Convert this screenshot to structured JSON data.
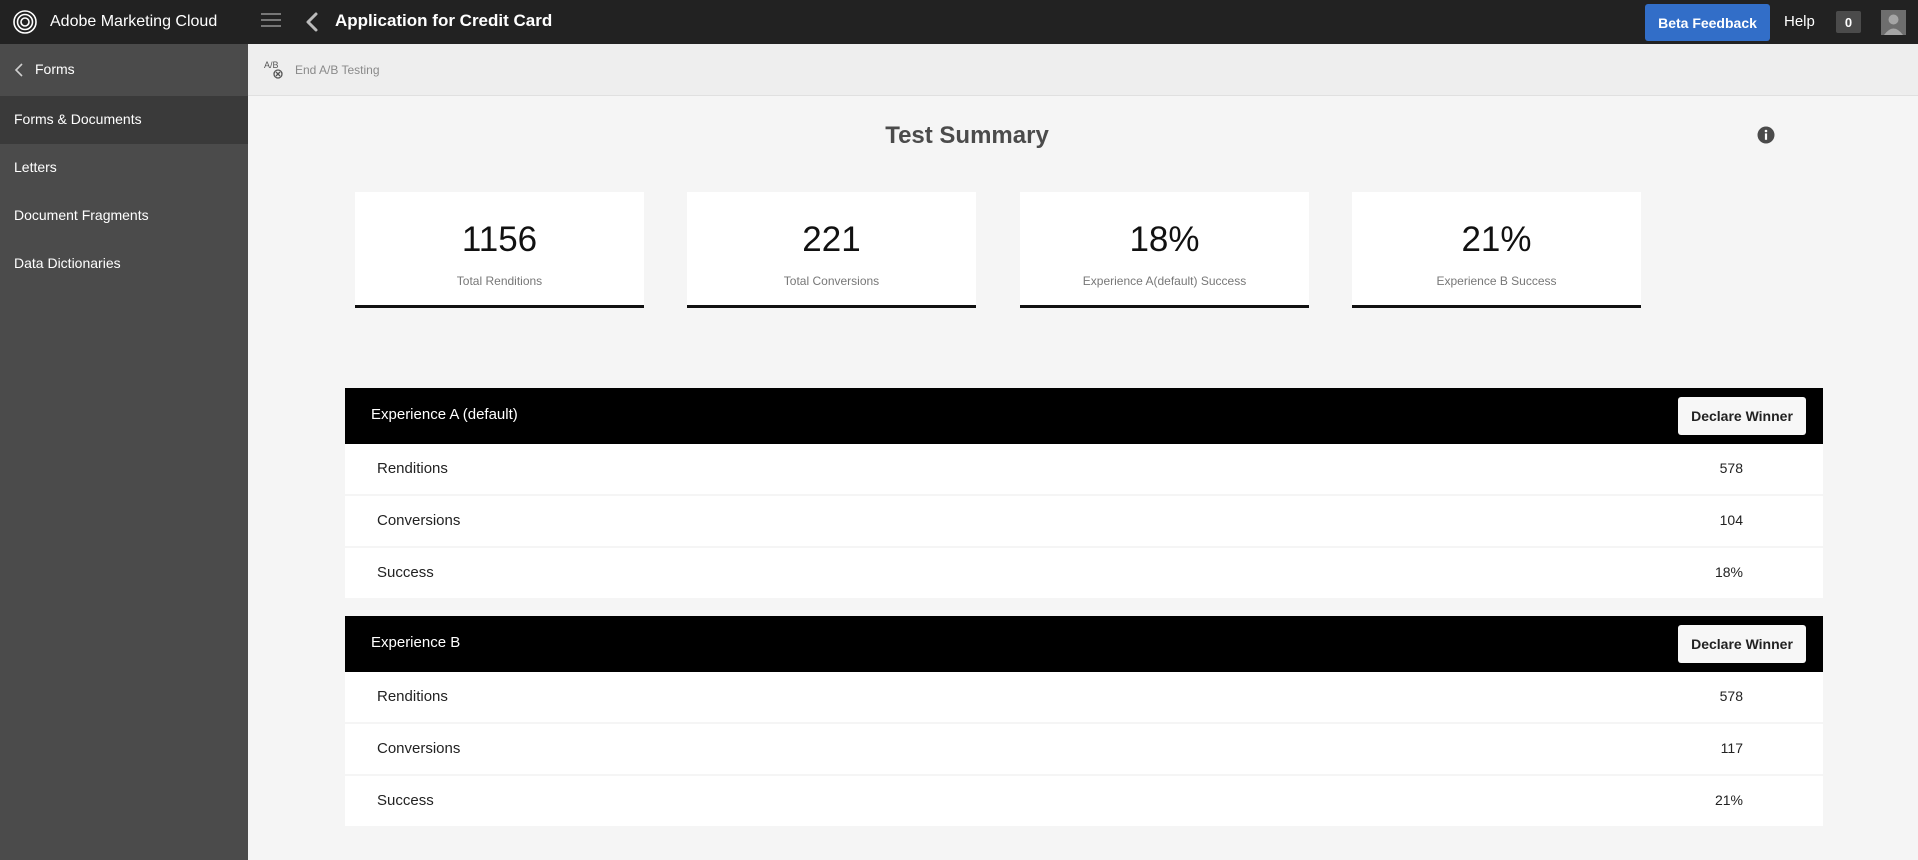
{
  "header": {
    "brand_name": "Adobe Marketing Cloud",
    "app_title": "Application for Credit Card",
    "beta_feedback_label": "Beta Feedback",
    "help_label": "Help",
    "notification_count": "0",
    "accent_color": "#326ec8"
  },
  "sidebar": {
    "back_label": "Forms",
    "items": [
      {
        "label": "Forms & Documents",
        "active": true
      },
      {
        "label": "Letters"
      },
      {
        "label": "Document Fragments"
      },
      {
        "label": "Data Dictionaries"
      }
    ]
  },
  "actionbar": {
    "end_ab_label": "End A/B Testing",
    "ab_icon_text": "A/B"
  },
  "main": {
    "title": "Test Summary",
    "cards": [
      {
        "value": "1156",
        "caption": "Total Renditions"
      },
      {
        "value": "221",
        "caption": "Total Conversions"
      },
      {
        "value": "18%",
        "caption": "Experience A(default) Success"
      },
      {
        "value": "21%",
        "caption": "Experience B Success"
      }
    ],
    "experiences": [
      {
        "title": "Experience A (default)",
        "declare_label": "Declare Winner",
        "rows": [
          {
            "label": "Renditions",
            "value": "578"
          },
          {
            "label": "Conversions",
            "value": "104"
          },
          {
            "label": "Success",
            "value": "18%"
          }
        ]
      },
      {
        "title": "Experience B",
        "declare_label": "Declare Winner",
        "rows": [
          {
            "label": "Renditions",
            "value": "578"
          },
          {
            "label": "Conversions",
            "value": "117"
          },
          {
            "label": "Success",
            "value": "21%"
          }
        ]
      }
    ]
  }
}
